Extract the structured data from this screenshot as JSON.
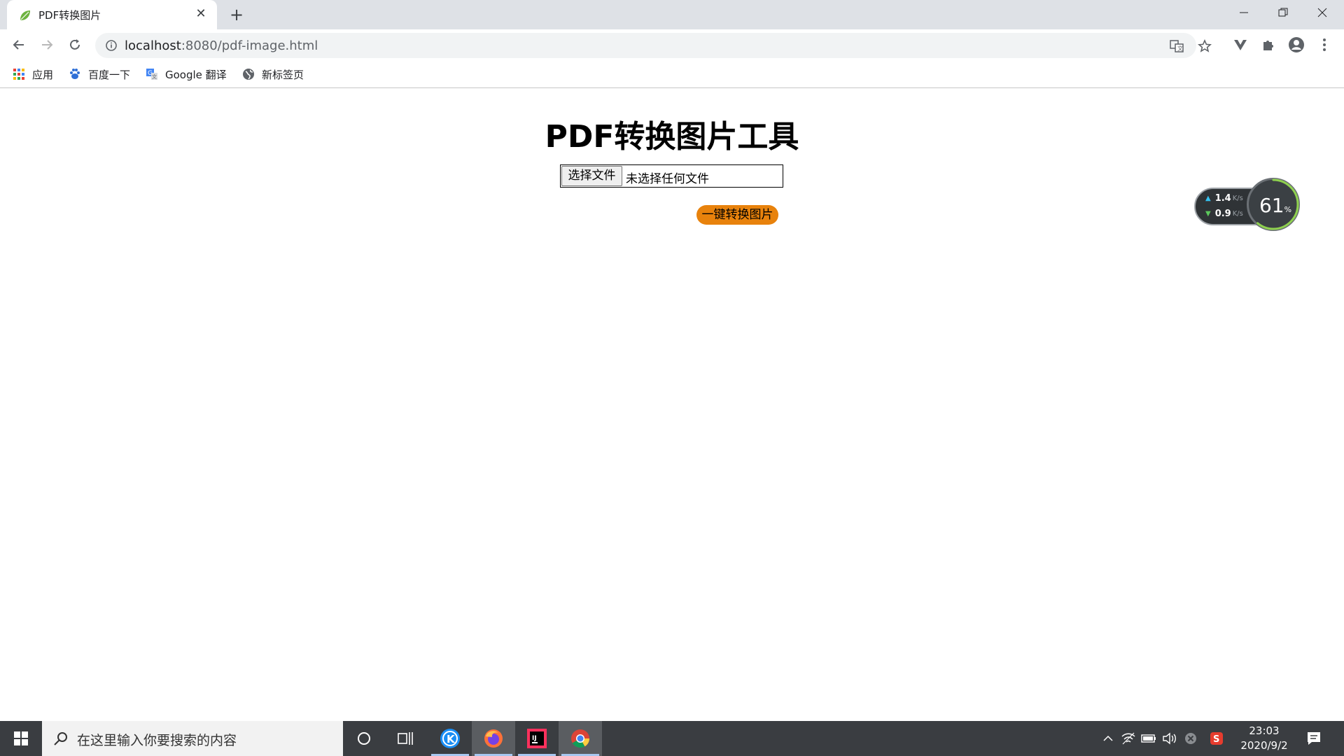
{
  "browser": {
    "tab_title": "PDF转换图片",
    "url_host": "localhost",
    "url_path": ":8080/pdf-image.html",
    "bookmarks": [
      {
        "label": "应用",
        "icon": "apps-grid-icon"
      },
      {
        "label": "百度一下",
        "icon": "baidu-paw-icon"
      },
      {
        "label": "Google 翻译",
        "icon": "google-translate-icon"
      },
      {
        "label": "新标签页",
        "icon": "globe-icon"
      }
    ]
  },
  "page": {
    "title": "PDF转换图片工具",
    "file_button_label": "选择文件",
    "file_status": "未选择任何文件",
    "convert_button_label": "一键转换图片",
    "accent_color": "#e8820c"
  },
  "net_widget": {
    "upload": "1.4",
    "download": "0.9",
    "unit": "K/s",
    "percent": "61",
    "percent_sign": "%",
    "level": 0.61
  },
  "taskbar": {
    "search_placeholder": "在这里输入你要搜索的内容",
    "time": "23:03",
    "date": "2020/9/2",
    "apps": [
      "cortana-icon",
      "task-view-icon",
      "kugou-icon",
      "firefox-icon",
      "intellij-icon",
      "chrome-icon"
    ]
  }
}
